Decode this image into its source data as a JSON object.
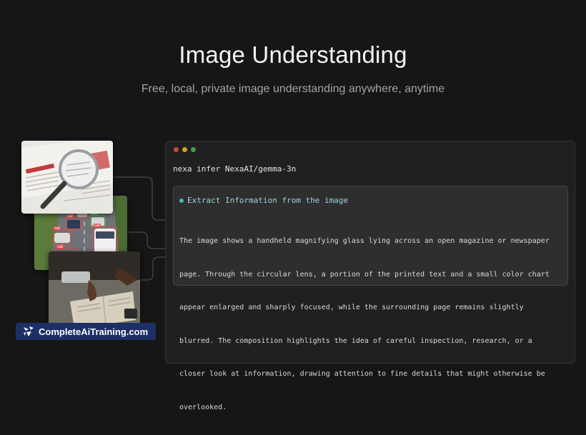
{
  "hero": {
    "title": "Image Understanding",
    "subtitle": "Free, local, private image understanding anywhere, anytime"
  },
  "terminal": {
    "window_dots": [
      "#c8463f",
      "#d4a028",
      "#3aa04a"
    ],
    "command": "nexa infer NexaAI/gemma-3n",
    "output": {
      "status_color": "#4fb6c4",
      "header": "Extract Information from the image",
      "lines": [
        "The image shows a handheld magnifying glass lying across an open magazine or newspaper",
        "page. Through the circular lens, a portion of the printed text and a small color chart",
        "appear enlarged and sharply focused, while the surrounding page remains slightly",
        "blurred. The composition highlights the idea of careful inspection, research, or a",
        "closer look at information, drawing attention to fine details that might otherwise be",
        "overlooked."
      ]
    }
  },
  "thumbnails": {
    "magnifier": {
      "icon": "magnifying-glass-photo"
    },
    "traffic": {
      "icon": "traffic-detection-photo",
      "labels": [
        "car",
        "car",
        "car",
        "car",
        "car",
        "car"
      ]
    },
    "reading": {
      "icon": "reading-book-photo"
    }
  },
  "watermark": {
    "text": "CompleteAiTraining.com",
    "icon": "brand-logo-icon",
    "color": "#1d2f66"
  }
}
